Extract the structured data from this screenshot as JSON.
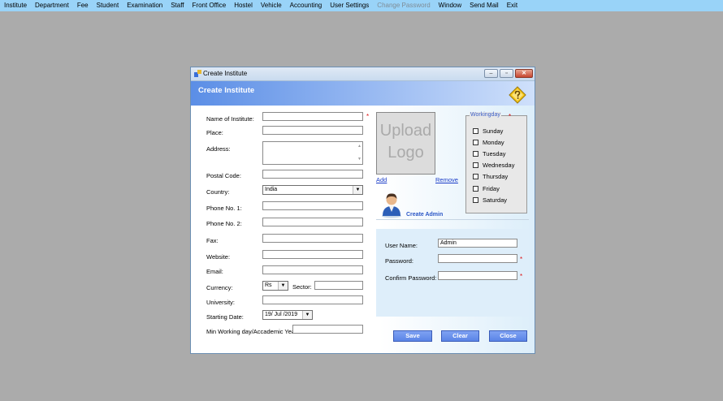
{
  "menu": [
    "Institute",
    "Department",
    "Fee",
    "Student",
    "Examination",
    "Staff",
    "Front Office",
    "Hostel",
    "Vehicle",
    "Accounting",
    "User Settings",
    "Change Password",
    "Window",
    "Send Mail",
    "Exit"
  ],
  "window": {
    "title": "Create Institute",
    "header": "Create Institute",
    "min_glyph": "–",
    "max_glyph": "▫",
    "close_glyph": "✕"
  },
  "form": {
    "name_label": "Name of Institute:",
    "place_label": "Place:",
    "address_label": "Address:",
    "postal_label": "Postal Code:",
    "country_label": "Country:",
    "country_value": "India",
    "phone1_label": "Phone No. 1:",
    "phone2_label": "Phone No. 2:",
    "fax_label": "Fax:",
    "website_label": "Website:",
    "email_label": "Email:",
    "currency_label": "Currency:",
    "currency_value": "Rs",
    "sector_label": "Sector:",
    "university_label": "University:",
    "start_label": "Starting Date:",
    "start_value": "19/ Jul /2019",
    "minwork_label": "Min Working day/Accademic Year:",
    "required_mark": "*"
  },
  "logo": {
    "line1": "Upload",
    "line2": "Logo",
    "add": "Add",
    "remove": "Remove"
  },
  "workingday": {
    "legend": "Workingday",
    "days": [
      "Sunday",
      "Monday",
      "Tuesday",
      "Wednesday",
      "Thursday",
      "Friday",
      "Saturday"
    ]
  },
  "admin": {
    "title": "Create Admin",
    "username_label": "User Name:",
    "username_value": "Admin",
    "password_label": "Password:",
    "confirm_label": "Confirm Password:"
  },
  "buttons": {
    "save": "Save",
    "clear": "Clear",
    "close": "Close"
  },
  "colors": {
    "menubar": "#99d3f8",
    "header": "#5b8ee6",
    "button": "#6a90ec",
    "required": "#dd1111"
  }
}
